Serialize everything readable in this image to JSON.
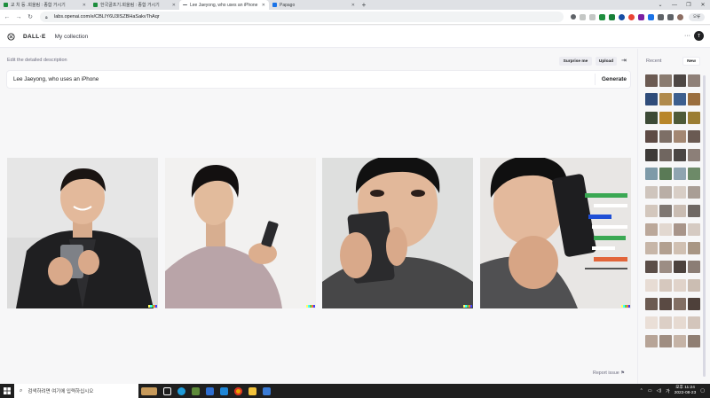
{
  "browser": {
    "tabs": [
      {
        "title": "교 치 등 .회울림 : 종합 거시기",
        "favicon_color": "#1e8e3e",
        "active": false
      },
      {
        "title": "한국골프기.회울림 : 종합 거시기",
        "favicon_color": "#1e8e3e",
        "active": false
      },
      {
        "title": "Lee Jaeyong, who uses an iPhone",
        "favicon_color": "#5f6368",
        "active": true
      },
      {
        "title": "Papago",
        "favicon_color": "#1a73e8",
        "active": false
      }
    ],
    "url": "labs.openai.com/e/CBLIY6U3ISZBHaSakvThAqr",
    "profile_label": "오류"
  },
  "app": {
    "brand": "DALL·E",
    "nav_my_collection": "My collection",
    "avatar_initial": "T"
  },
  "editor": {
    "label": "Edit the detailed description",
    "surprise_label": "Surprise me",
    "upload_label": "Upload",
    "prompt_value": "Lee Jaeyong, who uses an iPhone",
    "generate_label": "Generate",
    "report_label": "Report issue"
  },
  "results": {
    "image_count": 4,
    "signature_colors": [
      "#ffff66",
      "#42ffff",
      "#51da4c",
      "#ff6e3c",
      "#3c46ff"
    ]
  },
  "sidebar": {
    "title": "Recent",
    "new_label": "New"
  },
  "taskbar": {
    "search_placeholder": "검색하려면 여기에 입력하십시오",
    "time": "오후 11:24",
    "date": "2022-08-23"
  }
}
